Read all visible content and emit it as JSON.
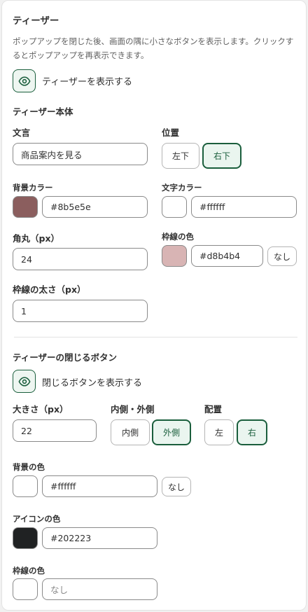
{
  "teaser": {
    "title": "ティーザー",
    "description": "ポップアップを閉じた後、画面の隅に小さなボタンを表示します。クリックするとポップアップを再表示できます。",
    "show_label": "ティーザーを表示する",
    "show_icon": "eye-icon"
  },
  "body": {
    "title": "ティーザー本体",
    "text_label": "文言",
    "text_value": "商品案内を見る",
    "position_label": "位置",
    "position_options": [
      "左下",
      "右下"
    ],
    "position_selected": "右下",
    "bg_color_label": "背景カラー",
    "bg_color": "#8b5e5e",
    "text_color_label": "文字カラー",
    "text_color": "#ffffff",
    "radius_label": "角丸（px）",
    "radius_value": "24",
    "border_color_label": "枠線の色",
    "border_color": "#d8b4b4",
    "border_none": "なし",
    "border_width_label": "枠線の太さ（px）",
    "border_width_value": "1"
  },
  "close_button": {
    "title": "ティーザーの閉じるボタン",
    "show_label": "閉じるボタンを表示する",
    "show_icon": "eye-icon",
    "size_label": "大きさ（px）",
    "size_value": "22",
    "inout_label": "内側・外側",
    "inout_options": [
      "内側",
      "外側"
    ],
    "inout_selected": "外側",
    "placement_label": "配置",
    "placement_options": [
      "左",
      "右"
    ],
    "placement_selected": "右",
    "bg_color_label": "背景の色",
    "bg_color": "#ffffff",
    "bg_none": "なし",
    "icon_color_label": "アイコンの色",
    "icon_color": "#202223",
    "border_color_label": "枠線の色",
    "border_color_placeholder": "なし"
  },
  "colors": {
    "accent": "#1a5e3c",
    "accent_bg": "#eaf5ef"
  }
}
